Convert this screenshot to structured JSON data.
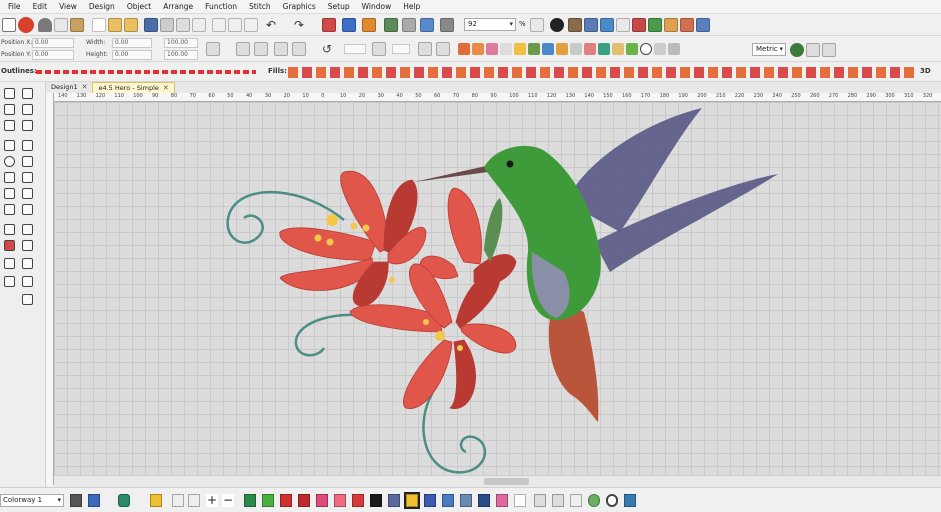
{
  "menu": [
    "File",
    "Edit",
    "View",
    "Design",
    "Object",
    "Arrange",
    "Function",
    "Stitch",
    "Graphics",
    "Setup",
    "Window",
    "Help"
  ],
  "toolbar": {
    "zoom_value": "92",
    "zoom_unit": "%",
    "units_value": "Metric"
  },
  "properties": {
    "position_x_label": "Position X:",
    "position_x_value": "0.00",
    "position_y_label": "Position Y:",
    "position_y_value": "0.00",
    "width_label": "Width:",
    "width_value": "0.00",
    "height_label": "Height:",
    "height_value": "0.00",
    "scale_w_value": "100.00",
    "scale_h_value": "100.00"
  },
  "row3": {
    "outlines_label": "Outlines:",
    "fills_label": "Fills:",
    "three_d_label": "3D"
  },
  "tabs": [
    {
      "label": "Design1"
    },
    {
      "label": "e4.5 Hero - Simple"
    }
  ],
  "ruler_labels": [
    "140",
    "130",
    "120",
    "110",
    "100",
    "90",
    "80",
    "70",
    "60",
    "50",
    "40",
    "30",
    "20",
    "10",
    "0",
    "10",
    "20",
    "30",
    "40",
    "50",
    "60",
    "70",
    "80",
    "90",
    "100",
    "110",
    "120",
    "130",
    "140",
    "150",
    "160",
    "170",
    "180",
    "190",
    "200",
    "210",
    "220",
    "230",
    "240",
    "250",
    "260",
    "270",
    "280",
    "290",
    "300",
    "310",
    "320"
  ],
  "bottom": {
    "colorway_value": "Colorway 1"
  },
  "colors": {
    "flower_red": "#e0564a",
    "flower_dark": "#b93a33",
    "flower_center": "#f3c94a",
    "leaf_green": "#5a8f52",
    "stem_blue": "#4c8e84",
    "bird_green": "#3f9b3a",
    "bird_wing": "#5a5a86",
    "bird_tail": "#b9553a",
    "bird_belly": "#8a8fa8"
  }
}
